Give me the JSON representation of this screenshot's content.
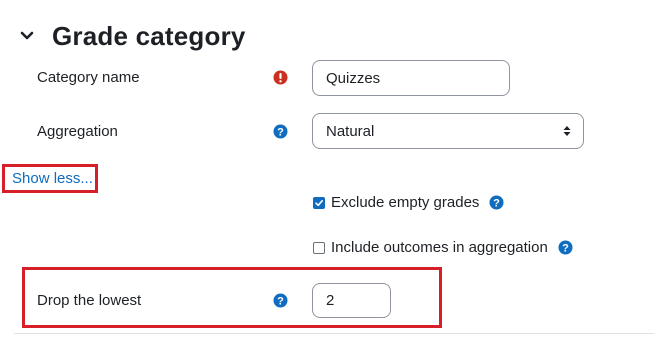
{
  "section": {
    "title": "Grade category"
  },
  "fields": {
    "category_name": {
      "label": "Category name",
      "value": "Quizzes"
    },
    "aggregation": {
      "label": "Aggregation",
      "value": "Natural"
    },
    "show_less": "Show less...",
    "exclude_empty": {
      "label": "Exclude empty grades",
      "checked": true
    },
    "include_outcomes": {
      "label": "Include outcomes in aggregation",
      "checked": false
    },
    "drop_lowest": {
      "label": "Drop the lowest",
      "value": "2"
    }
  },
  "colors": {
    "highlight": "#d71f2a",
    "help_icon": "#0f6cbf",
    "required_icon": "#ca3120",
    "link": "#0f6cbf"
  }
}
